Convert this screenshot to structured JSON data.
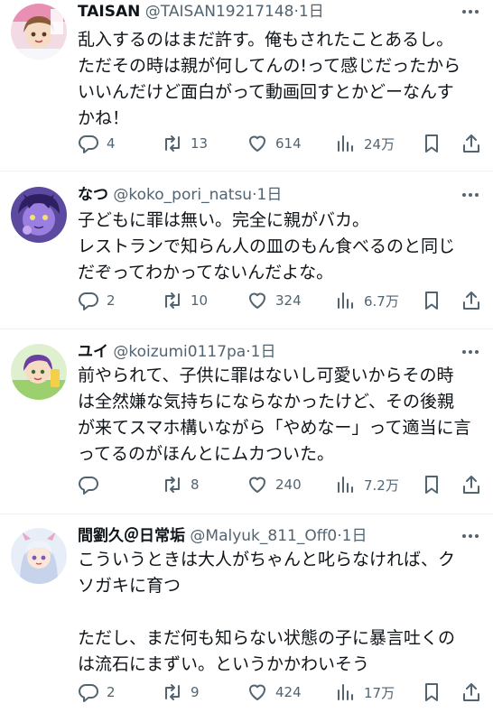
{
  "tweets": [
    {
      "name": "TAISAN",
      "handle": "@TAISAN19217148",
      "sep": "·",
      "time": "1日",
      "text": "乱入するのはまだ許す。俺もされたことあるし。\nただその時は親が何してんの!って感じだったから\nいいんだけど面白がって動画回すとかどーなんす\nかね！",
      "replies": "4",
      "retweets": "13",
      "likes": "614",
      "views": "24万",
      "avatar_color": "#d9a4c0"
    },
    {
      "name": "なつ",
      "handle": "@koko_pori_natsu",
      "sep": "·",
      "time": "1日",
      "text": "子どもに罪は無い。完全に親がバカ。\nレストランで知らん人の皿のもん食べるのと同じ\nだぞってわかってないんだよな。",
      "replies": "2",
      "retweets": "10",
      "likes": "324",
      "views": "6.7万",
      "avatar_color": "#7a5fb8"
    },
    {
      "name": "ユイ",
      "handle": "@koizumi0117pa",
      "sep": "·",
      "time": "1日",
      "text": "前やられて、子供に罪はないし可愛いからその時\nは全然嫌な気持ちにならなかったけど、その後親\nが来てスマホ構いながら「やめなー」って適当に言\nってるのがほんとにムカついた。",
      "replies": "",
      "retweets": "8",
      "likes": "240",
      "views": "7.2万",
      "avatar_color": "#8dc86a"
    },
    {
      "name": "間劉久＠日常垢",
      "handle": "@Malyuk_811_Off0",
      "sep": "·",
      "time": "1日",
      "text": "こういうときは大人がちゃんと叱らなければ、ク\nソガキに育つ\n\nただし、まだ何も知らない状態の子に暴言吐くの\nは流石にまずい。というかかわいそう",
      "replies": "2",
      "retweets": "9",
      "likes": "424",
      "views": "17万",
      "avatar_color": "#c9d9ec"
    }
  ],
  "icons": {
    "reply": "reply-icon",
    "retweet": "retweet-icon",
    "like": "heart-icon",
    "views": "views-icon",
    "bookmark": "bookmark-icon",
    "share": "share-icon",
    "more": "more-icon"
  },
  "colors": {
    "text": "#0f1419",
    "secondary": "#536471",
    "divider": "#eff3f4"
  }
}
